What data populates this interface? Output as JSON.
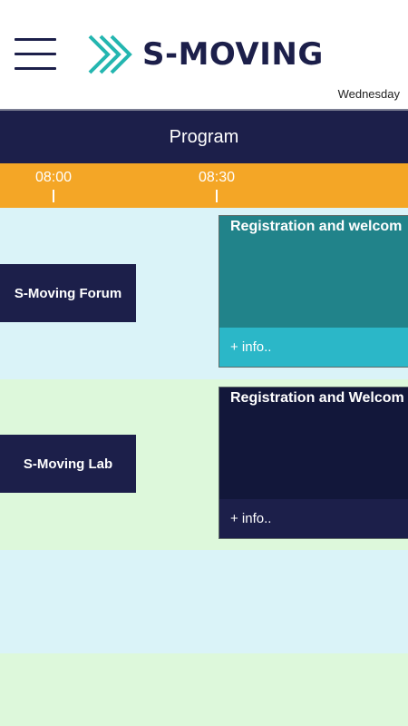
{
  "app": {
    "name": "S-MOVING",
    "day": "Wednesday"
  },
  "program": {
    "label": "Program"
  },
  "timeline": {
    "ticks": [
      "08:00",
      "08:30"
    ]
  },
  "rows": [
    {
      "room": "S-Moving Forum",
      "event": {
        "title": "Registration and welcom",
        "info": "+ info.."
      }
    },
    {
      "room": "S-Moving Lab",
      "event": {
        "title": "Registration and Welcom",
        "info": "+ info.."
      }
    }
  ],
  "colors": {
    "navy": "#1c1f4a",
    "orange": "#f4a626",
    "teal_event": "#21838a",
    "teal_info": "#2bb7c8",
    "dark_event": "#12173a",
    "row_blue": "#daf3f8",
    "row_green": "#ddf8db"
  }
}
